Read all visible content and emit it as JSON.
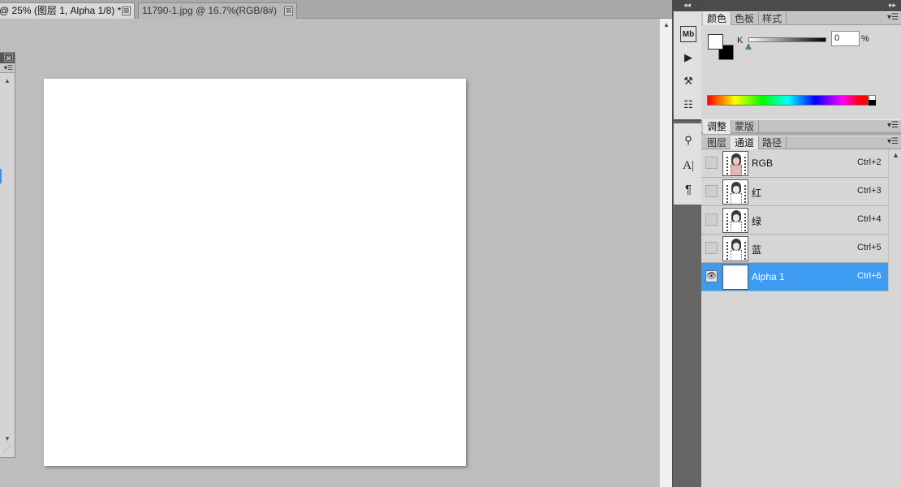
{
  "tabs": [
    {
      "label": "@ 25% (图层 1, Alpha 1/8) *",
      "close": "⊠"
    },
    {
      "label": "11790-1.jpg @ 16.7%(RGB/8#)",
      "close": "⊠"
    }
  ],
  "floating_panel": {
    "close": "✕",
    "menu": "▾☰",
    "up": "▲",
    "down": "▼",
    "grip": "⋰"
  },
  "main_scroll": {
    "up": "▲"
  },
  "dock": {
    "collapse": "◂◂",
    "icons": [
      {
        "name": "mini-bridge-icon",
        "glyph": "Mb"
      },
      {
        "name": "play-icon",
        "glyph": "▶"
      },
      {
        "name": "tool-presets-icon",
        "glyph": "⚒"
      },
      {
        "name": "clone-source-icon",
        "glyph": "☷"
      },
      {
        "name": "brush-icon",
        "glyph": "⚲"
      },
      {
        "name": "character-icon",
        "glyph": "A|"
      },
      {
        "name": "paragraph-icon",
        "glyph": "¶"
      }
    ]
  },
  "panels": {
    "collapse": "▸▸",
    "menu": "▾☰",
    "color_tabs": [
      "颜色",
      "色板",
      "样式"
    ],
    "color": {
      "k_label": "K",
      "k_value": "0",
      "unit": "%",
      "k_fraction": 0.0
    },
    "adj_tabs": [
      "调整",
      "蒙版"
    ],
    "channel_tabs": [
      "图层",
      "通道",
      "路径"
    ],
    "channels": [
      {
        "name": "RGB",
        "shortcut": "Ctrl+2",
        "eye": "",
        "selected": false
      },
      {
        "name": "红",
        "shortcut": "Ctrl+3",
        "eye": "",
        "selected": false
      },
      {
        "name": "绿",
        "shortcut": "Ctrl+4",
        "eye": "",
        "selected": false
      },
      {
        "name": "蓝",
        "shortcut": "Ctrl+5",
        "eye": "",
        "selected": false
      },
      {
        "name": "Alpha 1",
        "shortcut": "Ctrl+6",
        "eye": "👁",
        "selected": true
      }
    ],
    "scroll_up": "▲"
  }
}
